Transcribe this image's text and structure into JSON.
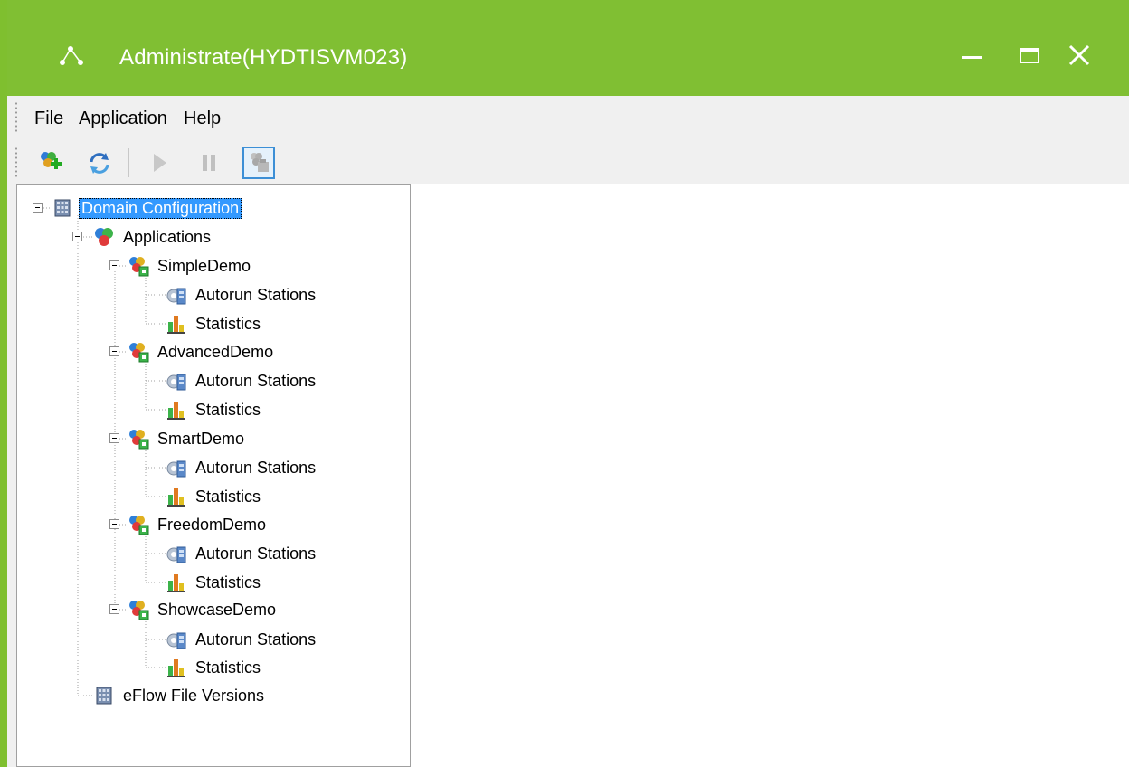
{
  "window": {
    "title": "Administrate(HYDTISVM023)",
    "accent_color": "#80bf33",
    "icons": {
      "app": "network-nodes-icon",
      "minimize": "minimize-icon",
      "maximize": "maximize-icon",
      "close": "close-icon"
    }
  },
  "menu": {
    "items": [
      "File",
      "Application",
      "Help"
    ]
  },
  "toolbar": {
    "buttons": [
      {
        "icon": "add-application-icon",
        "enabled": true
      },
      {
        "icon": "refresh-icon",
        "enabled": true
      },
      {
        "icon": "play-icon",
        "enabled": false
      },
      {
        "icon": "pause-icon",
        "enabled": false
      },
      {
        "icon": "station-icon",
        "enabled": false,
        "checked": true
      }
    ]
  },
  "tree": {
    "root": {
      "label": "Domain Configuration",
      "icon": "database-icon",
      "selected": true
    },
    "applications_node": {
      "label": "Applications",
      "icon": "applications-icon"
    },
    "applications": [
      {
        "label": "SimpleDemo",
        "children": [
          "Autorun Stations",
          "Statistics"
        ]
      },
      {
        "label": "AdvancedDemo",
        "children": [
          "Autorun Stations",
          "Statistics"
        ]
      },
      {
        "label": "SmartDemo",
        "children": [
          "Autorun Stations",
          "Statistics"
        ]
      },
      {
        "label": "FreedomDemo",
        "children": [
          "Autorun Stations",
          "Statistics"
        ]
      },
      {
        "label": "ShowcaseDemo",
        "children": [
          "Autorun Stations",
          "Statistics"
        ]
      }
    ],
    "file_versions": {
      "label": "eFlow File Versions",
      "icon": "database-icon"
    }
  }
}
